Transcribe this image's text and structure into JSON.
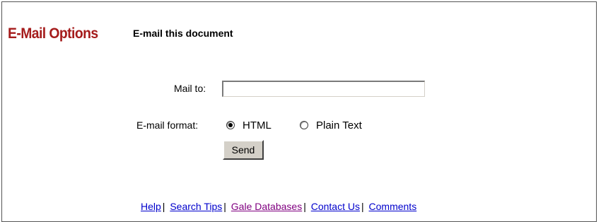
{
  "colors": {
    "brand_title": "#a51c1c",
    "link": "#0000cc",
    "visited_link": "#800080",
    "button_face": "#d4d0c8",
    "frame_border": "#555555"
  },
  "header": {
    "brand_title": "E-Mail Options",
    "section_title": "E-mail this document"
  },
  "form": {
    "mailto_label": "Mail to:",
    "mailto_value": "",
    "format_label": "E-mail format:",
    "format_options": [
      {
        "label": "HTML",
        "checked": true
      },
      {
        "label": "Plain Text",
        "checked": false
      }
    ],
    "send_label": "Send"
  },
  "footer": {
    "links": [
      {
        "label": "Help",
        "visited": false
      },
      {
        "label": "Search Tips",
        "visited": false
      },
      {
        "label": "Gale Databases",
        "visited": true
      },
      {
        "label": "Contact Us",
        "visited": false
      },
      {
        "label": "Comments",
        "visited": false
      }
    ],
    "separator": "|"
  }
}
